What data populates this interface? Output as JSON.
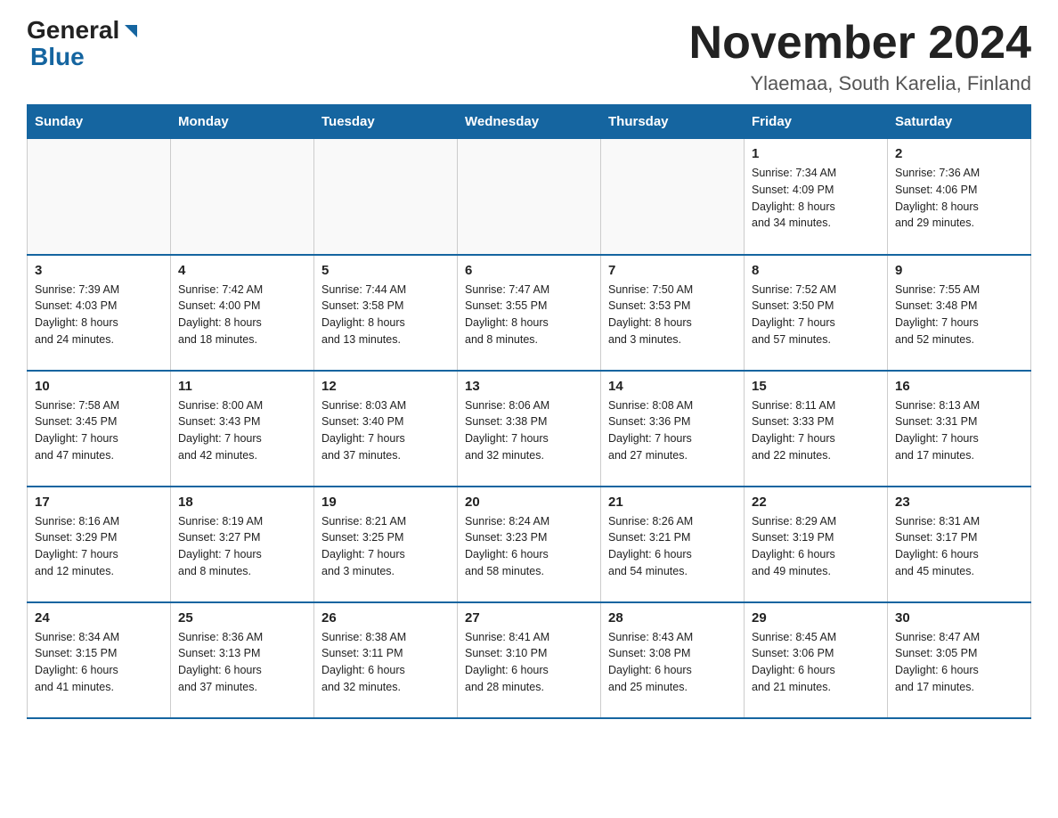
{
  "header": {
    "logo_general": "General",
    "logo_blue": "Blue",
    "month_title": "November 2024",
    "location": "Ylaemaa, South Karelia, Finland"
  },
  "days_of_week": [
    "Sunday",
    "Monday",
    "Tuesday",
    "Wednesday",
    "Thursday",
    "Friday",
    "Saturday"
  ],
  "weeks": [
    [
      {
        "day": "",
        "info": ""
      },
      {
        "day": "",
        "info": ""
      },
      {
        "day": "",
        "info": ""
      },
      {
        "day": "",
        "info": ""
      },
      {
        "day": "",
        "info": ""
      },
      {
        "day": "1",
        "info": "Sunrise: 7:34 AM\nSunset: 4:09 PM\nDaylight: 8 hours\nand 34 minutes."
      },
      {
        "day": "2",
        "info": "Sunrise: 7:36 AM\nSunset: 4:06 PM\nDaylight: 8 hours\nand 29 minutes."
      }
    ],
    [
      {
        "day": "3",
        "info": "Sunrise: 7:39 AM\nSunset: 4:03 PM\nDaylight: 8 hours\nand 24 minutes."
      },
      {
        "day": "4",
        "info": "Sunrise: 7:42 AM\nSunset: 4:00 PM\nDaylight: 8 hours\nand 18 minutes."
      },
      {
        "day": "5",
        "info": "Sunrise: 7:44 AM\nSunset: 3:58 PM\nDaylight: 8 hours\nand 13 minutes."
      },
      {
        "day": "6",
        "info": "Sunrise: 7:47 AM\nSunset: 3:55 PM\nDaylight: 8 hours\nand 8 minutes."
      },
      {
        "day": "7",
        "info": "Sunrise: 7:50 AM\nSunset: 3:53 PM\nDaylight: 8 hours\nand 3 minutes."
      },
      {
        "day": "8",
        "info": "Sunrise: 7:52 AM\nSunset: 3:50 PM\nDaylight: 7 hours\nand 57 minutes."
      },
      {
        "day": "9",
        "info": "Sunrise: 7:55 AM\nSunset: 3:48 PM\nDaylight: 7 hours\nand 52 minutes."
      }
    ],
    [
      {
        "day": "10",
        "info": "Sunrise: 7:58 AM\nSunset: 3:45 PM\nDaylight: 7 hours\nand 47 minutes."
      },
      {
        "day": "11",
        "info": "Sunrise: 8:00 AM\nSunset: 3:43 PM\nDaylight: 7 hours\nand 42 minutes."
      },
      {
        "day": "12",
        "info": "Sunrise: 8:03 AM\nSunset: 3:40 PM\nDaylight: 7 hours\nand 37 minutes."
      },
      {
        "day": "13",
        "info": "Sunrise: 8:06 AM\nSunset: 3:38 PM\nDaylight: 7 hours\nand 32 minutes."
      },
      {
        "day": "14",
        "info": "Sunrise: 8:08 AM\nSunset: 3:36 PM\nDaylight: 7 hours\nand 27 minutes."
      },
      {
        "day": "15",
        "info": "Sunrise: 8:11 AM\nSunset: 3:33 PM\nDaylight: 7 hours\nand 22 minutes."
      },
      {
        "day": "16",
        "info": "Sunrise: 8:13 AM\nSunset: 3:31 PM\nDaylight: 7 hours\nand 17 minutes."
      }
    ],
    [
      {
        "day": "17",
        "info": "Sunrise: 8:16 AM\nSunset: 3:29 PM\nDaylight: 7 hours\nand 12 minutes."
      },
      {
        "day": "18",
        "info": "Sunrise: 8:19 AM\nSunset: 3:27 PM\nDaylight: 7 hours\nand 8 minutes."
      },
      {
        "day": "19",
        "info": "Sunrise: 8:21 AM\nSunset: 3:25 PM\nDaylight: 7 hours\nand 3 minutes."
      },
      {
        "day": "20",
        "info": "Sunrise: 8:24 AM\nSunset: 3:23 PM\nDaylight: 6 hours\nand 58 minutes."
      },
      {
        "day": "21",
        "info": "Sunrise: 8:26 AM\nSunset: 3:21 PM\nDaylight: 6 hours\nand 54 minutes."
      },
      {
        "day": "22",
        "info": "Sunrise: 8:29 AM\nSunset: 3:19 PM\nDaylight: 6 hours\nand 49 minutes."
      },
      {
        "day": "23",
        "info": "Sunrise: 8:31 AM\nSunset: 3:17 PM\nDaylight: 6 hours\nand 45 minutes."
      }
    ],
    [
      {
        "day": "24",
        "info": "Sunrise: 8:34 AM\nSunset: 3:15 PM\nDaylight: 6 hours\nand 41 minutes."
      },
      {
        "day": "25",
        "info": "Sunrise: 8:36 AM\nSunset: 3:13 PM\nDaylight: 6 hours\nand 37 minutes."
      },
      {
        "day": "26",
        "info": "Sunrise: 8:38 AM\nSunset: 3:11 PM\nDaylight: 6 hours\nand 32 minutes."
      },
      {
        "day": "27",
        "info": "Sunrise: 8:41 AM\nSunset: 3:10 PM\nDaylight: 6 hours\nand 28 minutes."
      },
      {
        "day": "28",
        "info": "Sunrise: 8:43 AM\nSunset: 3:08 PM\nDaylight: 6 hours\nand 25 minutes."
      },
      {
        "day": "29",
        "info": "Sunrise: 8:45 AM\nSunset: 3:06 PM\nDaylight: 6 hours\nand 21 minutes."
      },
      {
        "day": "30",
        "info": "Sunrise: 8:47 AM\nSunset: 3:05 PM\nDaylight: 6 hours\nand 17 minutes."
      }
    ]
  ]
}
